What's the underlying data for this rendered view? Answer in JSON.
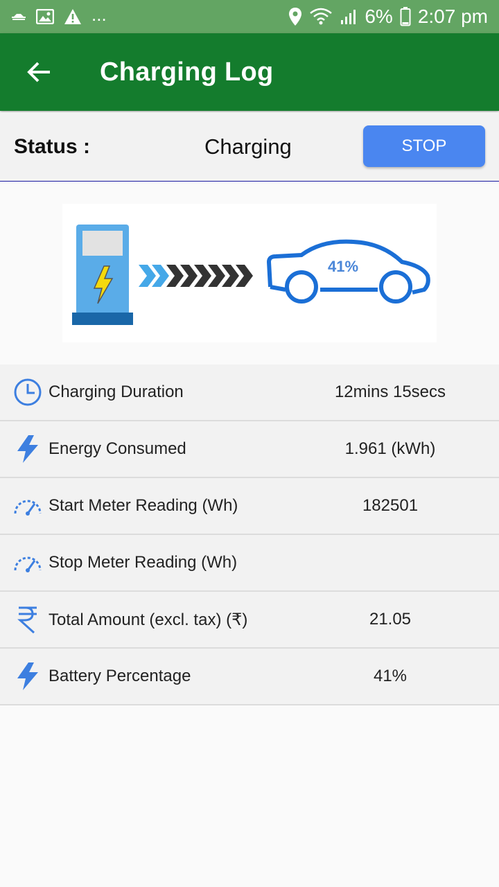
{
  "statusbar": {
    "dots": "...",
    "battery_percent": "6%",
    "time": "2:07 pm"
  },
  "appbar": {
    "title": "Charging Log"
  },
  "status": {
    "label": "Status :",
    "value": "Charging",
    "stop_label": "STOP"
  },
  "banner": {
    "car_percent": "41%"
  },
  "details": [
    {
      "icon": "clock-icon",
      "label": "Charging Duration",
      "value": "12mins 15secs"
    },
    {
      "icon": "lightning-icon",
      "label": "Energy Consumed",
      "value": "1.961 (kWh)"
    },
    {
      "icon": "speedometer-icon",
      "label": "Start Meter Reading (Wh)",
      "value": "182501"
    },
    {
      "icon": "speedometer-icon",
      "label": "Stop Meter Reading (Wh)",
      "value": ""
    },
    {
      "icon": "rupee-icon",
      "label": "Total Amount (excl. tax) (₹)",
      "value": "21.05"
    },
    {
      "icon": "lightning-icon",
      "label": "Battery Percentage",
      "value": "41%"
    }
  ],
  "colors": {
    "statusbar": "#63a563",
    "appbar": "#147c2d",
    "stop_button": "#4a86f0",
    "icon_blue": "#3d7fe0"
  }
}
